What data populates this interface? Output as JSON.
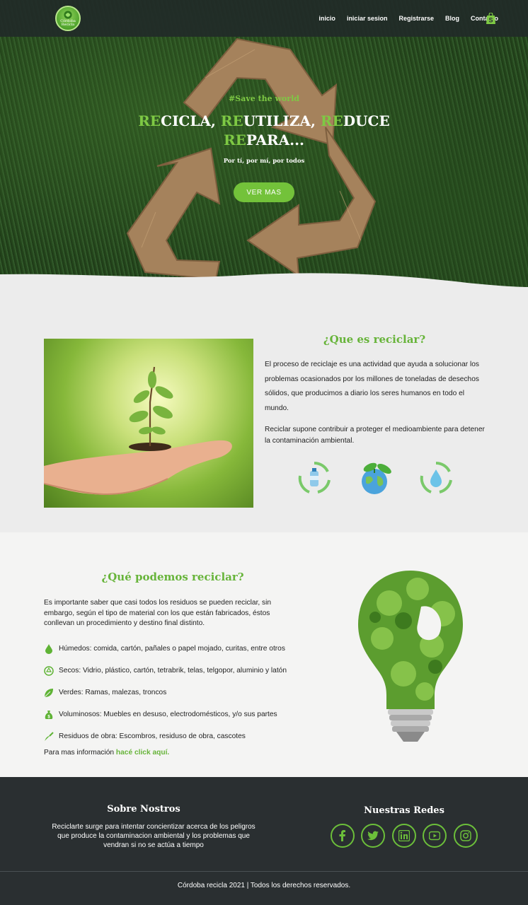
{
  "brand": {
    "logo_text_line1": "Córdoba",
    "logo_text_line2": "Recicla"
  },
  "nav": {
    "items": [
      "inicio",
      "iniciar sesion",
      "Registrarse",
      "Blog",
      "Contacto"
    ],
    "cart_icon": "shopify-bag-icon"
  },
  "hero": {
    "tag": "#Save the world",
    "title_line1": {
      "a_g": "RE",
      "a": "CICLA, ",
      "b_g": "RE",
      "b": "UTILIZA, ",
      "c_g": "RE",
      "c": "DUCE"
    },
    "title_line2": {
      "d_g": "RE",
      "d": "PARA..."
    },
    "subtitle": "Por tí, por mí, por todos",
    "button": "VER MAS"
  },
  "what_is": {
    "title": "¿Que es reciclar?",
    "p1": "El proceso de reciclaje es una actividad que ayuda a solucionar los problemas ocasionados por los millones de toneladas de desechos sólidos, que producimos a diario los seres humanos en todo el mundo.",
    "p2": "Reciclar supone contribuir a proteger el medioambiente para detener la contaminación ambiental.",
    "icons": [
      "recycle-bottle-icon",
      "earth-plant-icon",
      "recycle-water-icon"
    ]
  },
  "what_can": {
    "title": "¿Qué podemos reciclar?",
    "intro": "Es importante saber que casi todos los residuos se pueden reciclar, sin embargo, según el tipo de material con los que están fabricados, éstos conllevan un procedimiento y destino final distinto.",
    "items": [
      {
        "icon": "drop-icon",
        "text": "Húmedos: comida, cartón, pañales o papel mojado, curitas, entre otros"
      },
      {
        "icon": "recycle-circle-icon",
        "text": "Secos: Vidrio, plástico, cartón, tetrabrik, telas, telgopor, aluminio y latón"
      },
      {
        "icon": "leaf-icon",
        "text": "Verdes: Ramas, malezas, troncos"
      },
      {
        "icon": "money-bag-icon",
        "text": "Voluminosos: Muebles en desuso, electrodomésticos, y/o sus partes"
      },
      {
        "icon": "trowel-icon",
        "text": "Residuos de obra: Escombros, residuso de obra, cascotes"
      }
    ],
    "more_prefix": "Para mas información ",
    "more_link": "hacé click aquí."
  },
  "footer": {
    "about_title": "Sobre Nostros",
    "about_text": "Reciclarte surge para intentar concientizar acerca de los peligros que produce la contaminacion ambiental y los problemas que vendran si no se actúa a tiempo",
    "social_title": "Nuestras Redes",
    "social_icons": [
      "facebook-icon",
      "twitter-icon",
      "linkedin-icon",
      "youtube-icon",
      "instagram-icon"
    ],
    "copyright": "Córdoba recicla 2021 | Todos los derechos reservados."
  },
  "colors": {
    "accent": "#73c23a",
    "footer_bg": "#2a2f31",
    "section_bg": "#ececec"
  }
}
